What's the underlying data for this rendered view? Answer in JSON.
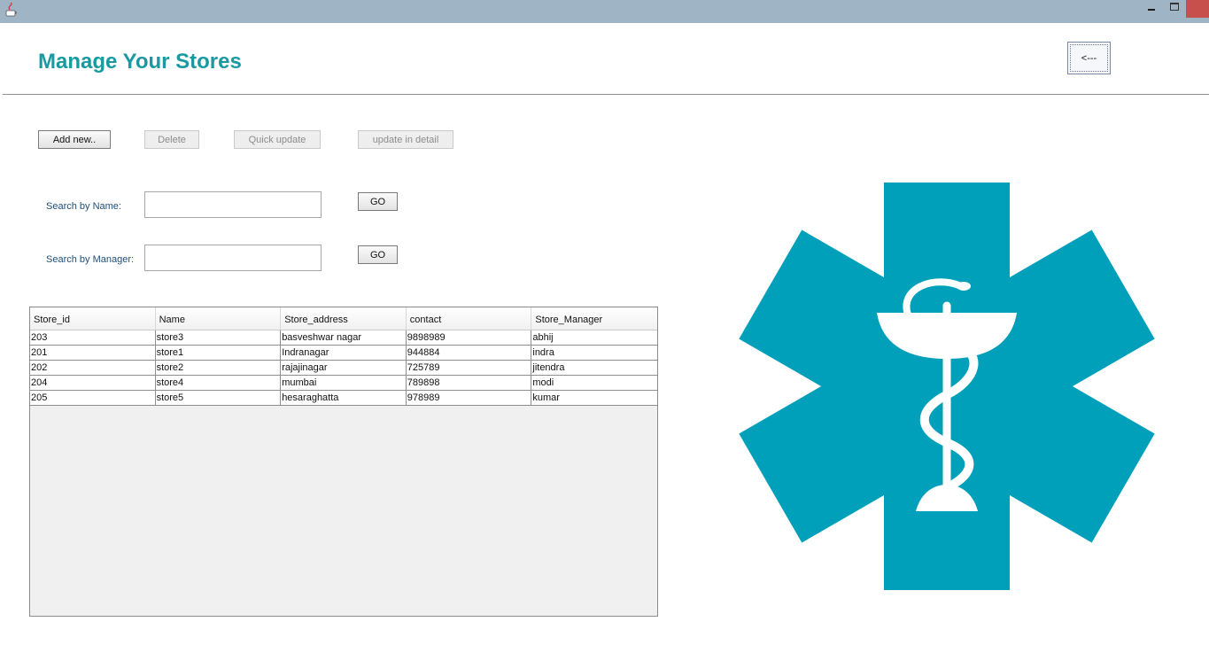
{
  "header": {
    "title": "Manage Your Stores",
    "back_label": "<---"
  },
  "actions": {
    "add_new": "Add new..",
    "delete": "Delete",
    "quick_update": "Quick update",
    "update_in_detail": "update in detail"
  },
  "search": {
    "by_name_label": "Search by Name:",
    "by_manager_label": "Search by Manager:",
    "by_name_value": "",
    "by_manager_value": "",
    "go_label": "GO"
  },
  "table": {
    "columns": [
      "Store_id",
      "Name",
      "Store_address",
      "contact",
      "Store_Manager"
    ],
    "rows": [
      [
        "203",
        "store3",
        "basveshwar nagar",
        "9898989",
        "abhij"
      ],
      [
        "201",
        "store1",
        "Indranagar",
        "944884",
        "indra"
      ],
      [
        "202",
        "store2",
        "rajajinagar",
        "725789",
        "jitendra"
      ],
      [
        "204",
        "store4",
        "mumbai",
        "789898",
        "modi"
      ],
      [
        "205",
        "store5",
        "hesaraghatta",
        "978989",
        "kumar"
      ]
    ]
  },
  "colors": {
    "title_teal": "#1a9aa0",
    "logo_teal": "#00a0ba",
    "label_blue": "#1f4e79",
    "titlebar": "#9fb4c5"
  },
  "icons": [
    "java-app-icon",
    "minimize-icon",
    "maximize-icon",
    "close-icon",
    "star-of-life-icon"
  ]
}
